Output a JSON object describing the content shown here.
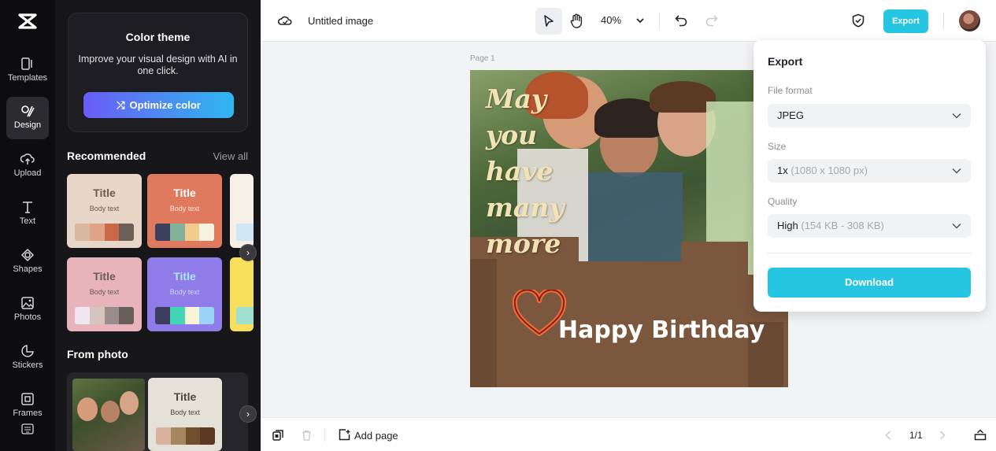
{
  "rail": {
    "items": [
      {
        "label": "Templates"
      },
      {
        "label": "Design"
      },
      {
        "label": "Upload"
      },
      {
        "label": "Text"
      },
      {
        "label": "Shapes"
      },
      {
        "label": "Photos"
      },
      {
        "label": "Stickers"
      },
      {
        "label": "Frames"
      }
    ],
    "active": "Design"
  },
  "panel": {
    "promo": {
      "title": "Color theme",
      "description": "Improve your visual design with AI in one click.",
      "button_label": "Optimize color"
    },
    "recommended": {
      "title": "Recommended",
      "view_all": "View all",
      "cards": [
        {
          "title": "Title",
          "body": "Body text",
          "bg": "#e8d7c9",
          "title_color": "#6a5a50",
          "swatches": [
            "#d9b89d",
            "#dfa38a",
            "#c86a47",
            "#6b5f57"
          ]
        },
        {
          "title": "Title",
          "body": "Body text",
          "bg": "#e07a5f",
          "title_color": "#ffffff",
          "swatches": [
            "#3d405b",
            "#81b29a",
            "#f2cc8f",
            "#f4f1de"
          ]
        },
        {
          "title": "Title",
          "body": "Body text",
          "bg": "#e8b4bc",
          "title_color": "#6a5a5a",
          "swatches": [
            "#f0e6ef",
            "#d7c4be",
            "#9a8c8a",
            "#6a5e5a"
          ]
        },
        {
          "title": "Title",
          "body": "Body text",
          "bg": "#8f7ce8",
          "title_color": "#a7e8ff",
          "swatches": [
            "#3d3b5e",
            "#43d6b5",
            "#f6f3d6",
            "#9ad3f5"
          ]
        }
      ]
    },
    "from_photo": {
      "title": "From photo",
      "card": {
        "title": "Title",
        "body": "Body text",
        "swatches": [
          "#d8b29c",
          "#a48660",
          "#6f4f2e",
          "#5a3920"
        ]
      }
    }
  },
  "topbar": {
    "doc_title": "Untitled image",
    "zoom": "40%",
    "export_label": "Export"
  },
  "canvas": {
    "page_label": "Page 1",
    "cursive_text": [
      "May",
      "you",
      "have",
      "many",
      "more"
    ],
    "birthday_text": "Happy Birthday"
  },
  "export_panel": {
    "title": "Export",
    "file_format": {
      "label": "File format",
      "value": "JPEG"
    },
    "size": {
      "label": "Size",
      "value": "1x",
      "detail": "(1080 x 1080 px)"
    },
    "quality": {
      "label": "Quality",
      "value": "High",
      "detail": "(154 KB - 308 KB)"
    },
    "download_label": "Download"
  },
  "bottombar": {
    "add_page": "Add page",
    "pager": "1/1"
  },
  "colors": {
    "accent": "#26c6e2",
    "rail_bg": "#0d0d0f",
    "panel_bg": "#17171a"
  }
}
